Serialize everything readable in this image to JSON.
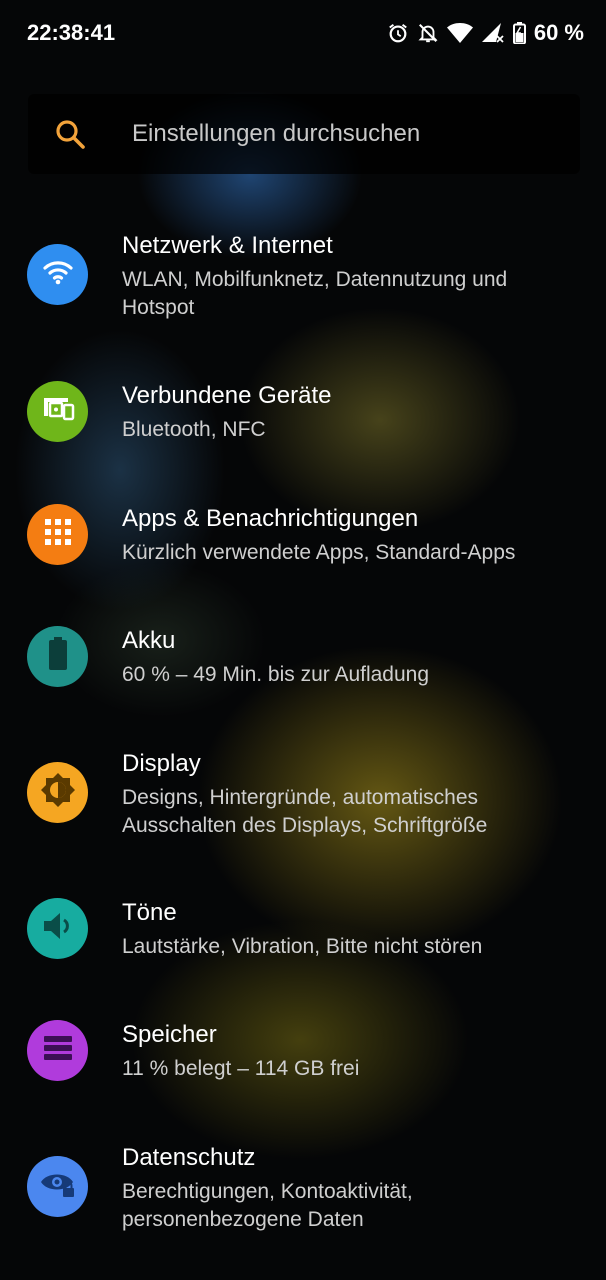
{
  "status_bar": {
    "time": "22:38:41",
    "battery_percent": "60 %",
    "icons": [
      "alarm-icon",
      "notifications-off-icon",
      "wifi-icon",
      "cell-signal-icon",
      "battery-charging-icon"
    ]
  },
  "search": {
    "placeholder": "Einstellungen durchsuchen",
    "icon": "search-icon",
    "icon_color": "#f2a33b"
  },
  "settings": [
    {
      "title": "Netzwerk & Internet",
      "subtitle": "WLAN, Mobilfunknetz, Datennutzung und Hotspot",
      "icon": "wifi-icon",
      "color": "#2f8ef0"
    },
    {
      "title": "Verbundene Geräte",
      "subtitle": "Bluetooth, NFC",
      "icon": "devices-icon",
      "color": "#6fb61a"
    },
    {
      "title": "Apps & Benachrichtigungen",
      "subtitle": "Kürzlich verwendete Apps, Standard-Apps",
      "icon": "apps-grid-icon",
      "color": "#f47d12"
    },
    {
      "title": "Akku",
      "subtitle": "60 % – 49 Min. bis zur Aufladung",
      "icon": "battery-icon",
      "color": "#1f9189"
    },
    {
      "title": "Display",
      "subtitle": "Designs, Hintergründe, automatisches Ausschalten des Displays, Schriftgröße",
      "icon": "brightness-icon",
      "color": "#f5a622"
    },
    {
      "title": "Töne",
      "subtitle": "Lautstärke, Vibration, Bitte nicht stören",
      "icon": "volume-icon",
      "color": "#17aca0"
    },
    {
      "title": "Speicher",
      "subtitle": "11 % belegt – 114 GB frei",
      "icon": "storage-icon",
      "color": "#b03bdc"
    },
    {
      "title": "Datenschutz",
      "subtitle": "Berechtigungen, Kontoaktivität, personenbezogene Daten",
      "icon": "privacy-eye-icon",
      "color": "#4b87ef"
    }
  ]
}
